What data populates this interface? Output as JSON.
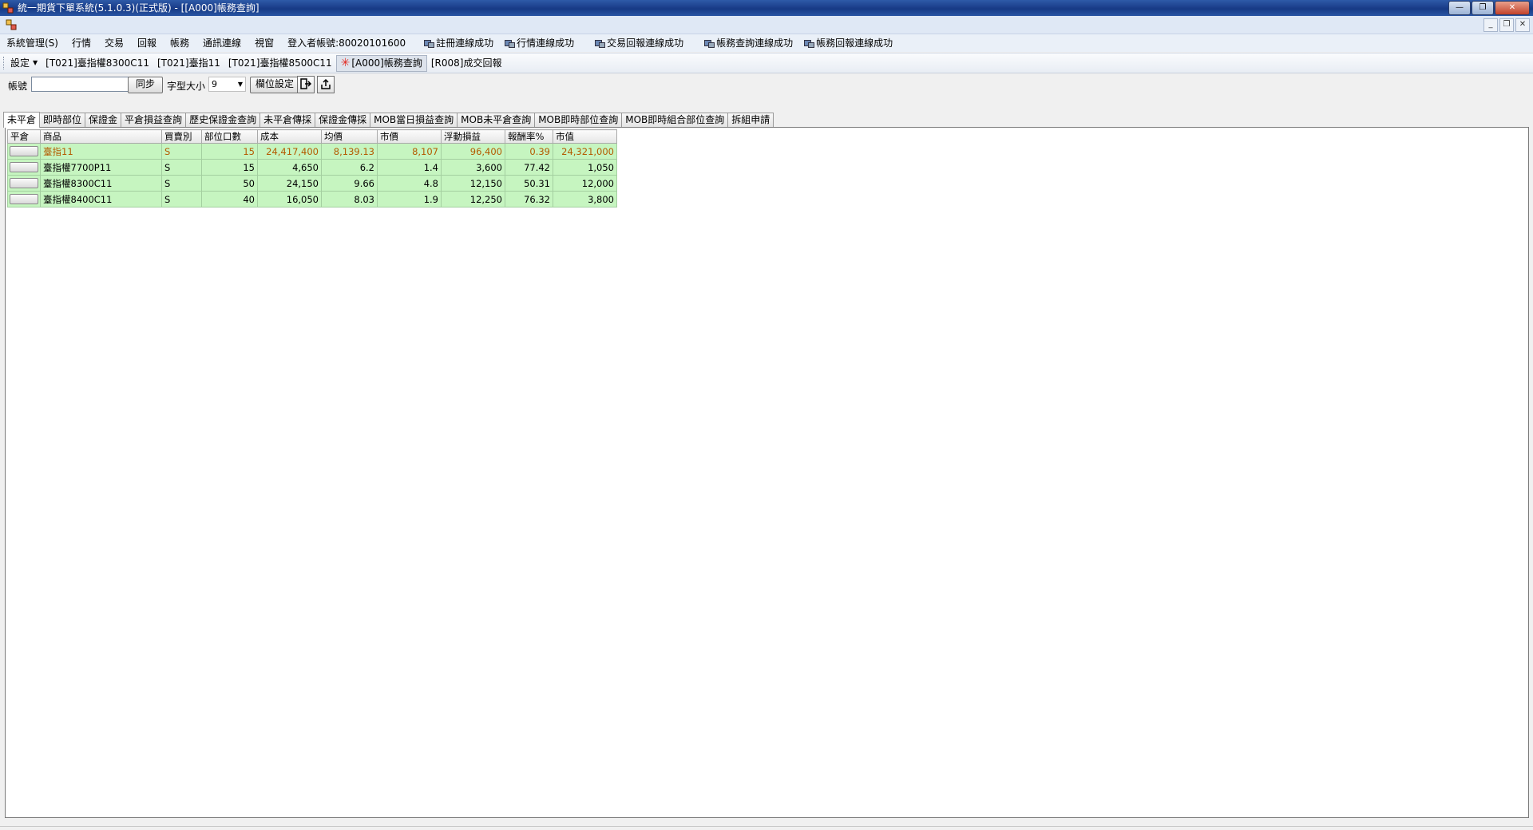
{
  "window": {
    "title": "統一期貨下單系統(5.1.0.3)(正式版) - [[A000]帳務查詢]",
    "minimize_label": "—",
    "maximize_label": "❐",
    "close_label": "✕"
  },
  "mdi": {
    "minimize_label": "_",
    "restore_label": "❐",
    "close_label": "✕"
  },
  "menubar": {
    "items": [
      "系統管理(S)",
      "行情",
      "交易",
      "回報",
      "帳務",
      "通訊連線",
      "視窗"
    ],
    "login_text": "登入者帳號:80020101600",
    "status": [
      "註冊連線成功",
      "行情連線成功",
      "交易回報連線成功",
      "帳務查詢連線成功",
      "帳務回報連線成功"
    ]
  },
  "toolstrip": {
    "settings_label": "設定",
    "items": [
      "[T021]臺指權8300C11",
      "[T021]臺指11",
      "[T021]臺指權8500C11",
      "[A000]帳務查詢",
      "[R008]成交回報"
    ],
    "active_index": 3
  },
  "filter": {
    "account_label": "帳號",
    "account_value": "",
    "sync_label": "同步",
    "font_label": "字型大小",
    "font_value": "9",
    "columns_label": "欄位設定"
  },
  "tabs": {
    "items": [
      "未平倉",
      "即時部位",
      "保證金",
      "平倉損益查詢",
      "歷史保證金查詢",
      "未平倉傳採",
      "保證金傳採",
      "MOB當日損益查詢",
      "MOB未平倉查詢",
      "MOB即時部位查詢",
      "MOB即時組合部位查詢",
      "拆組申請"
    ],
    "active_index": 0
  },
  "grid": {
    "headers": [
      "平倉",
      "商品",
      "買賣別",
      "部位口數",
      "成本",
      "均價",
      "市價",
      "浮動損益",
      "報酬率%",
      "市值"
    ],
    "rows": [
      [
        "",
        "臺指11",
        "S",
        "15",
        "24,417,400",
        "8,139.13",
        "8,107",
        "96,400",
        "0.39",
        "24,321,000"
      ],
      [
        "",
        "臺指權7700P11",
        "S",
        "15",
        "4,650",
        "6.2",
        "1.4",
        "3,600",
        "77.42",
        "1,050"
      ],
      [
        "",
        "臺指權8300C11",
        "S",
        "50",
        "24,150",
        "9.66",
        "4.8",
        "12,150",
        "50.31",
        "12,000"
      ],
      [
        "",
        "臺指權8400C11",
        "S",
        "40",
        "16,050",
        "8.03",
        "1.9",
        "12,250",
        "76.32",
        "3,800"
      ]
    ],
    "highlight_row_index": 0,
    "row_color": "#c6f5c0",
    "highlight_text_color": "#b45a00"
  }
}
